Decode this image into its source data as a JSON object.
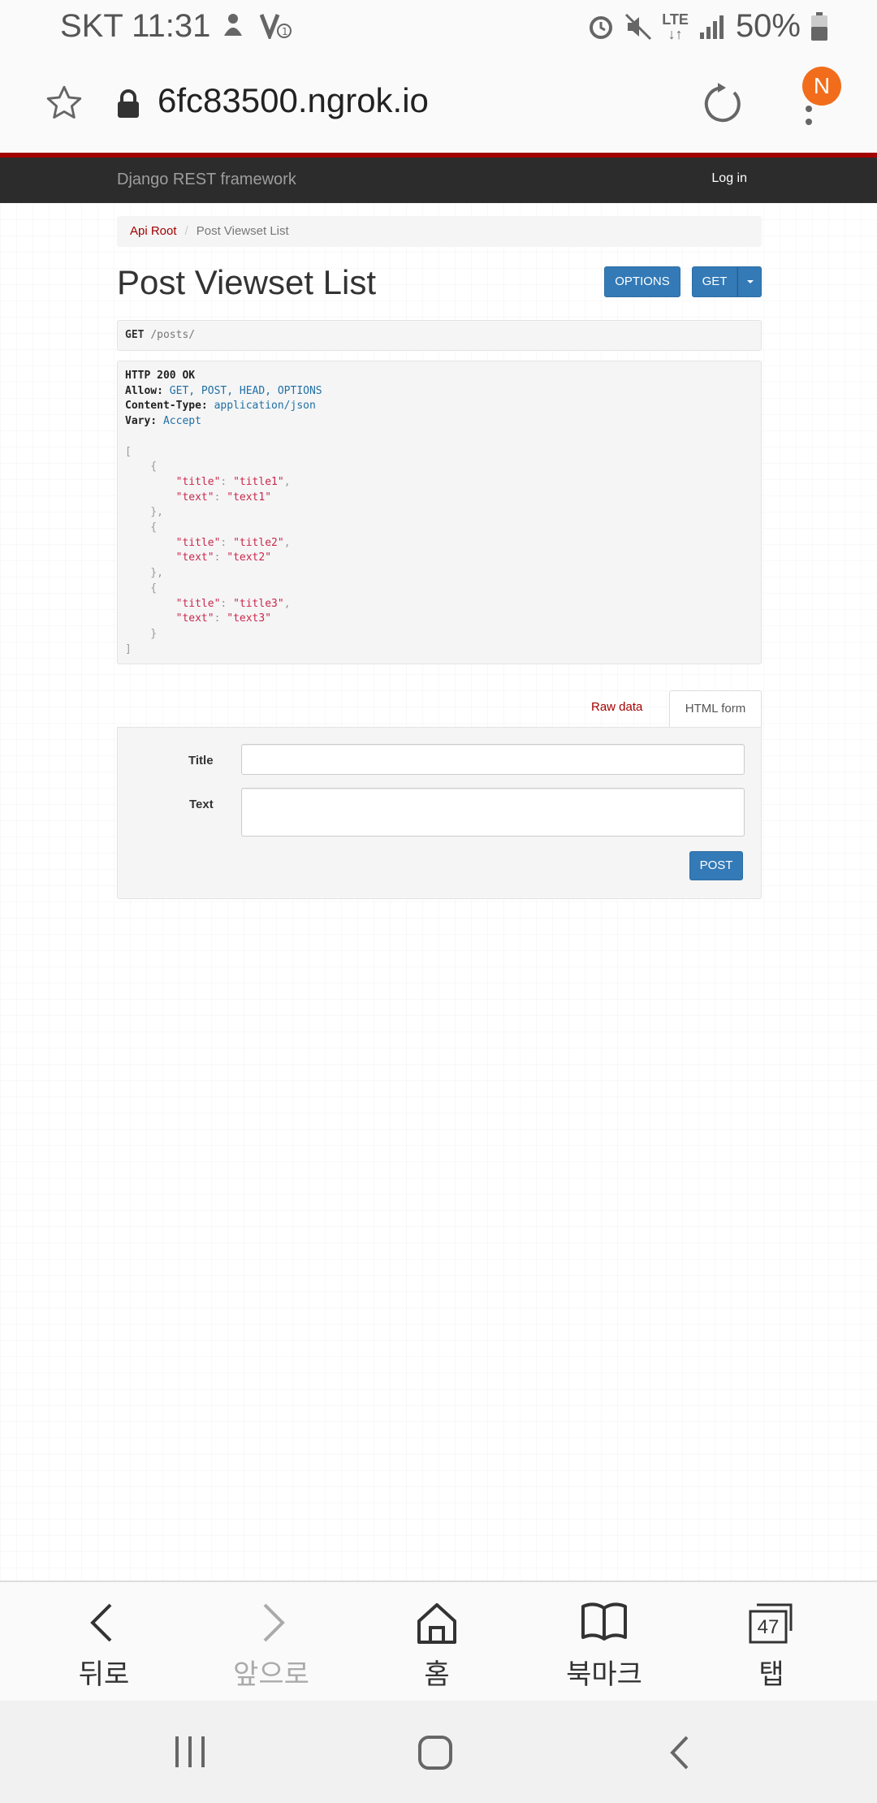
{
  "status_bar": {
    "carrier_time": "SKT 11:31",
    "network": "LTE",
    "battery": "50%"
  },
  "browser": {
    "url": "6fc83500.ngrok.io",
    "profile_initial": "N"
  },
  "navbar": {
    "brand": "Django REST framework",
    "login": "Log in"
  },
  "breadcrumb": {
    "root": "Api Root",
    "current": "Post Viewset List"
  },
  "page": {
    "title": "Post Viewset List",
    "options_button": "OPTIONS",
    "get_button": "GET"
  },
  "request": {
    "method": "GET",
    "path": "/posts/"
  },
  "response": {
    "status": "HTTP 200 OK",
    "allow_key": "Allow:",
    "allow_value": "GET, POST, HEAD, OPTIONS",
    "content_type_key": "Content-Type:",
    "content_type_value": "application/json",
    "vary_key": "Vary:",
    "vary_value": "Accept",
    "posts": [
      {
        "title": "title1",
        "text": "text1"
      },
      {
        "title": "title2",
        "text": "text2"
      },
      {
        "title": "title3",
        "text": "text3"
      }
    ]
  },
  "form": {
    "tab_raw": "Raw data",
    "tab_html": "HTML form",
    "title_label": "Title",
    "text_label": "Text",
    "post_button": "POST"
  },
  "toolbar": {
    "back": "뒤로",
    "forward": "앞으로",
    "home": "홈",
    "bookmarks": "북마크",
    "tabs": "탭",
    "tab_count": "47"
  },
  "colors": {
    "accent_red": "#a30000",
    "button_blue": "#337ab7",
    "navbar_dark": "#2c2c2c",
    "avatar_orange": "#f26d1b"
  }
}
